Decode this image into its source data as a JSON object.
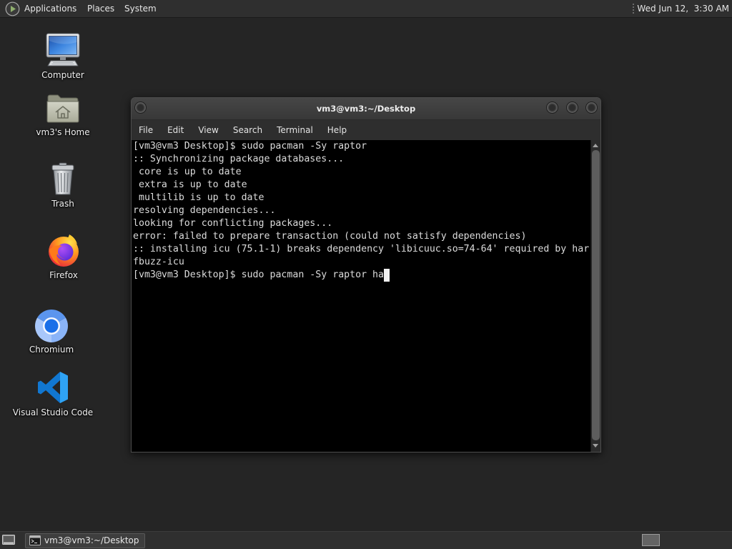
{
  "top_panel": {
    "menus": [
      "Applications",
      "Places",
      "System"
    ],
    "clock": "Wed Jun 12,  3:30 AM"
  },
  "desktop": {
    "icons": [
      {
        "label": "Computer",
        "icon": "computer-icon"
      },
      {
        "label": "vm3's Home",
        "icon": "home-folder-icon"
      },
      {
        "label": "Trash",
        "icon": "trash-icon"
      },
      {
        "label": "Firefox",
        "icon": "firefox-icon"
      },
      {
        "label": "Chromium",
        "icon": "chromium-icon"
      },
      {
        "label": "Visual Studio Code",
        "icon": "vscode-icon"
      }
    ]
  },
  "terminal": {
    "title": "vm3@vm3:~/Desktop",
    "menu": [
      "File",
      "Edit",
      "View",
      "Search",
      "Terminal",
      "Help"
    ],
    "lines": [
      "[vm3@vm3 Desktop]$ sudo pacman -Sy raptor",
      ":: Synchronizing package databases...",
      " core is up to date",
      " extra is up to date",
      " multilib is up to date",
      "resolving dependencies...",
      "looking for conflicting packages...",
      "error: failed to prepare transaction (could not satisfy dependencies)",
      ":: installing icu (75.1-1) breaks dependency 'libicuuc.so=74-64' required by har",
      "fbuzz-icu"
    ],
    "prompt": "[vm3@vm3 Desktop]$ ",
    "input": "sudo pacman -Sy raptor ha"
  },
  "bottom_panel": {
    "tasks": [
      {
        "label": "vm3@vm3:~/Desktop",
        "icon": "terminal-icon"
      }
    ]
  },
  "colors": {
    "desktop_bg": "#252525",
    "terminal_bg": "#000000",
    "terminal_fg": "#dcdcdc"
  }
}
